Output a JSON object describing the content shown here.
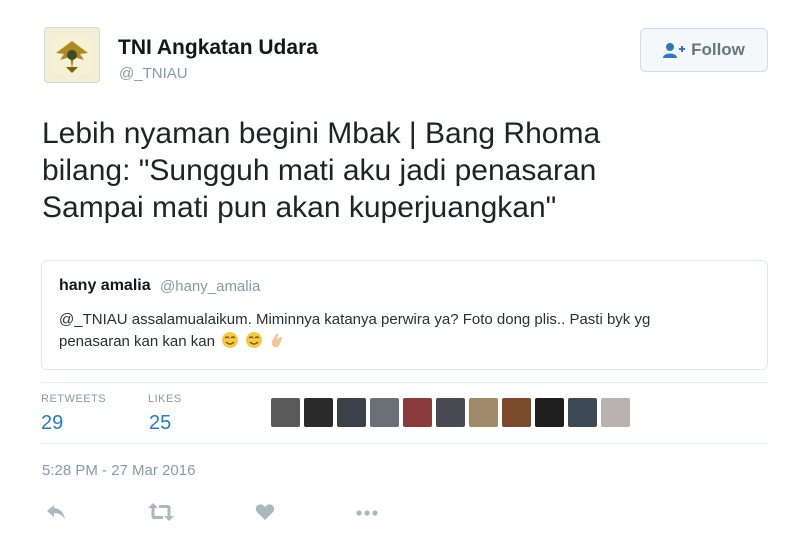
{
  "account": {
    "display_name": "TNI Angkatan Udara",
    "handle": "@_TNIAU"
  },
  "follow_button": {
    "label": "Follow",
    "icon": "add-user-icon"
  },
  "tweet": {
    "text": "Lebih nyaman begini Mbak | Bang Rhoma\nbilang: \"Sungguh mati aku jadi penasaran\nSampai mati pun akan kuperjuangkan\""
  },
  "quoted_tweet": {
    "name": "hany amalia",
    "handle": "@hany_amalia",
    "text": "@_TNIAU assalamualaikum. Miminnya katanya perwira ya? Foto dong plis.. Pasti byk yg penasaran kan kan kan",
    "emojis": [
      "relieved-face-emoji",
      "relieved-face-emoji",
      "clapping-hand-emoji"
    ]
  },
  "stats": {
    "retweets_label": "RETWEETS",
    "retweets_count": "29",
    "likes_label": "LIKES",
    "likes_count": "25",
    "liker_avatars_count": 11
  },
  "timestamp": "5:28 PM - 27 Mar 2016",
  "actions": [
    "reply-icon",
    "retweet-icon",
    "like-icon",
    "more-icon"
  ],
  "colors": {
    "accent": "#2b7bb9",
    "muted": "#8899a6",
    "text": "#292f33",
    "border": "#e1e8ed"
  }
}
